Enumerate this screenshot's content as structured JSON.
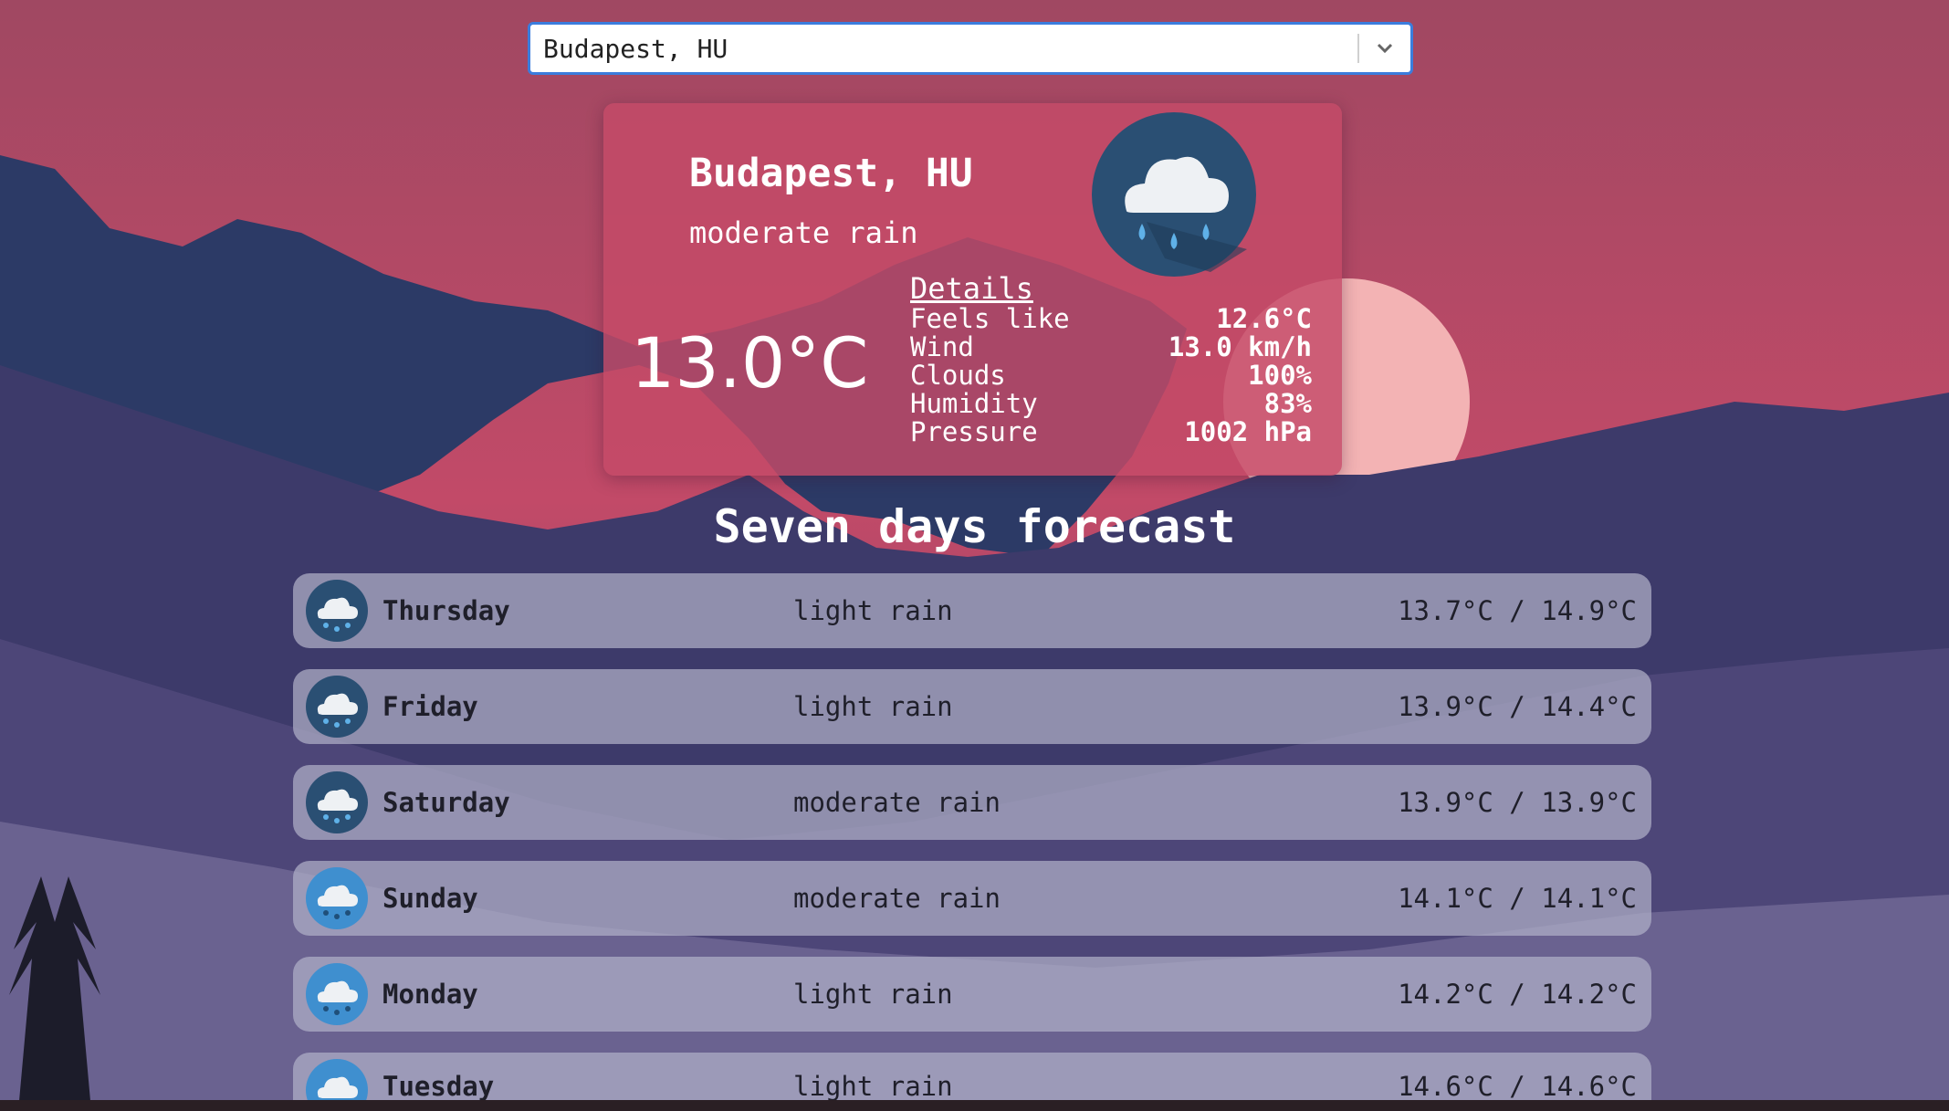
{
  "search": {
    "value": "Budapest, HU"
  },
  "current": {
    "city": "Budapest, HU",
    "description": "moderate rain",
    "temperature": "13.0°C",
    "icon": "rain-cloud-icon",
    "details": {
      "heading": "Details",
      "rows": [
        {
          "label": "Feels like",
          "value": "12.6°C"
        },
        {
          "label": "Wind",
          "value": "13.0 km/h"
        },
        {
          "label": "Clouds",
          "value": "100%"
        },
        {
          "label": "Humidity",
          "value": "83%"
        },
        {
          "label": "Pressure",
          "value": "1002 hPa"
        }
      ]
    }
  },
  "forecast": {
    "title": "Seven days forecast",
    "days": [
      {
        "day": "Thursday",
        "description": "light rain",
        "temps": "13.7°C / 14.9°C",
        "icon_color": "#2a4f73"
      },
      {
        "day": "Friday",
        "description": "light rain",
        "temps": "13.9°C / 14.4°C",
        "icon_color": "#2a4f73"
      },
      {
        "day": "Saturday",
        "description": "moderate rain",
        "temps": "13.9°C / 13.9°C",
        "icon_color": "#2a4f73"
      },
      {
        "day": "Sunday",
        "description": "moderate rain",
        "temps": "14.1°C / 14.1°C",
        "icon_color": "#3f8fcf"
      },
      {
        "day": "Monday",
        "description": "light rain",
        "temps": "14.2°C / 14.2°C",
        "icon_color": "#3f8fcf"
      },
      {
        "day": "Tuesday",
        "description": "light rain",
        "temps": "14.6°C / 14.6°C",
        "icon_color": "#3f8fcf"
      }
    ]
  },
  "colors": {
    "accent": "#3b7ddd",
    "card": "#c44a68",
    "sky_top": "#a04862",
    "sun": "#f3b3b4"
  }
}
